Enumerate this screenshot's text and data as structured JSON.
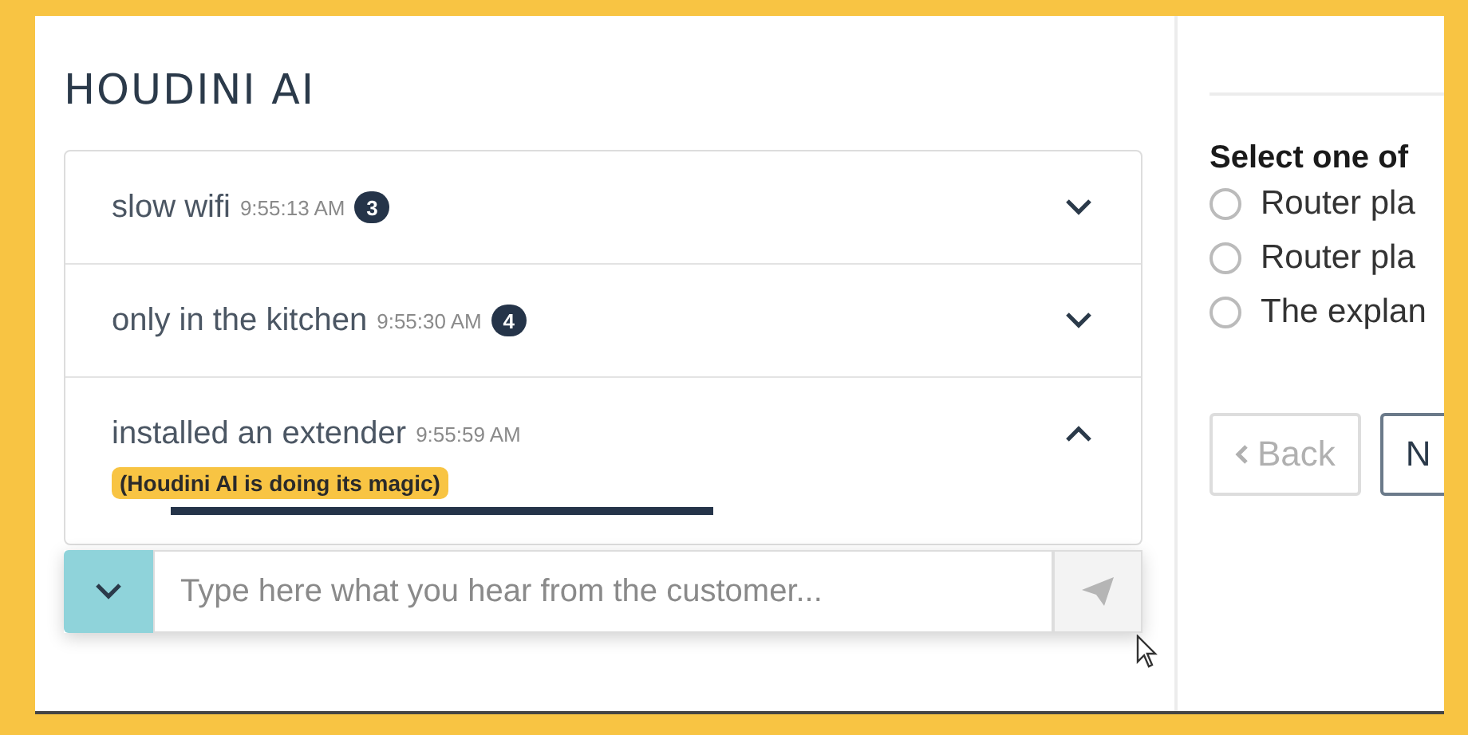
{
  "logo": "HOUDINI AI",
  "entries": [
    {
      "text": "slow wifi",
      "time": "9:55:13 AM",
      "badge": "3",
      "expanded": false
    },
    {
      "text": "only in the kitchen",
      "time": "9:55:30 AM",
      "badge": "4",
      "expanded": false
    },
    {
      "text": "installed an extender",
      "time": "9:55:59 AM",
      "expanded": true,
      "status": "(Houdini AI is doing its magic)"
    }
  ],
  "input": {
    "placeholder": "Type here what you hear from the customer..."
  },
  "question": {
    "prompt": "Select one of",
    "options": [
      {
        "label": "Router pla",
        "selected": false
      },
      {
        "label": "Router pla",
        "selected": false
      },
      {
        "label": "The explan",
        "selected": false
      }
    ],
    "buttons": [
      {
        "label": "Back",
        "kind": "back",
        "disabled": true
      },
      {
        "label": "N",
        "kind": "next",
        "disabled": false
      }
    ]
  }
}
